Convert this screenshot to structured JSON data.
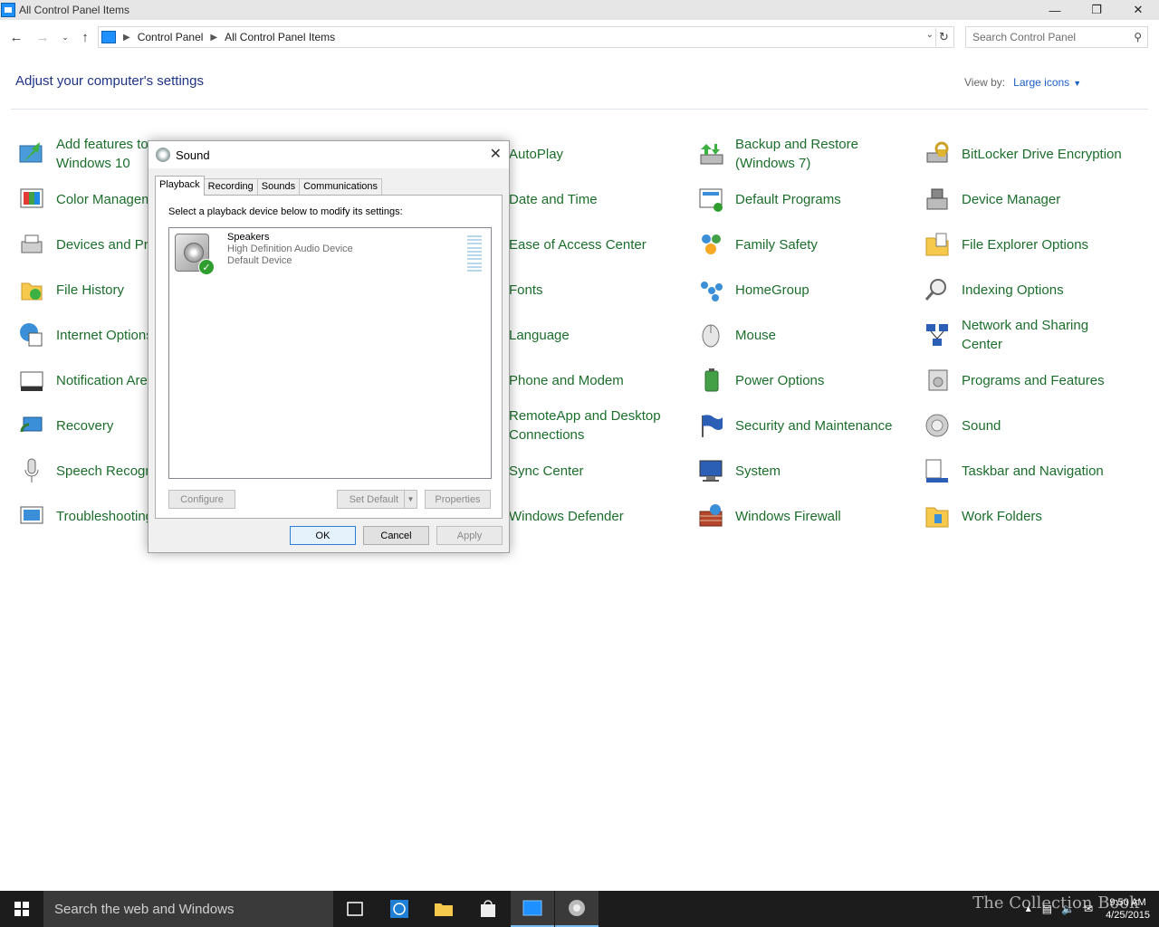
{
  "window": {
    "title": "All Control Panel Items"
  },
  "address": {
    "crumbs": [
      "Control Panel",
      "All Control Panel Items"
    ]
  },
  "search": {
    "placeholder": "Search Control Panel"
  },
  "header": {
    "heading": "Adjust your computer's settings",
    "view_by_label": "View by:",
    "view_by_value": "Large icons"
  },
  "items": [
    {
      "label": "Add features to Windows 10",
      "icon": "add-features-icon"
    },
    {
      "label": "Color Management",
      "icon": "color-management-icon"
    },
    {
      "label": "Devices and Printers",
      "icon": "devices-printers-icon"
    },
    {
      "label": "File History",
      "icon": "file-history-icon"
    },
    {
      "label": "Internet Options",
      "icon": "internet-options-icon"
    },
    {
      "label": "Notification Area Icons",
      "icon": "notification-area-icon"
    },
    {
      "label": "Recovery",
      "icon": "recovery-icon"
    },
    {
      "label": "Speech Recognition",
      "icon": "microphone-icon"
    },
    {
      "label": "Troubleshooting",
      "icon": "troubleshooting-icon"
    },
    {
      "label": "AutoPlay",
      "icon": "autoplay-icon"
    },
    {
      "label": "Date and Time",
      "icon": "clock-icon"
    },
    {
      "label": "Ease of Access Center",
      "icon": "ease-of-access-icon"
    },
    {
      "label": "Fonts",
      "icon": "fonts-icon"
    },
    {
      "label": "Language",
      "icon": "language-icon"
    },
    {
      "label": "Phone and Modem",
      "icon": "phone-icon"
    },
    {
      "label": "RemoteApp and Desktop Connections",
      "icon": "remoteapp-icon"
    },
    {
      "label": "Sync Center",
      "icon": "sync-icon"
    },
    {
      "label": "Windows Defender",
      "icon": "defender-icon"
    },
    {
      "label": "Backup and Restore (Windows 7)",
      "icon": "backup-icon"
    },
    {
      "label": "Default Programs",
      "icon": "default-programs-icon"
    },
    {
      "label": "Family Safety",
      "icon": "family-safety-icon"
    },
    {
      "label": "HomeGroup",
      "icon": "homegroup-icon"
    },
    {
      "label": "Mouse",
      "icon": "mouse-icon"
    },
    {
      "label": "Power Options",
      "icon": "power-options-icon"
    },
    {
      "label": "Security and Maintenance",
      "icon": "flag-icon"
    },
    {
      "label": "System",
      "icon": "system-icon"
    },
    {
      "label": "Windows Firewall",
      "icon": "firewall-icon"
    },
    {
      "label": "BitLocker Drive Encryption",
      "icon": "bitlocker-icon"
    },
    {
      "label": "Device Manager",
      "icon": "device-manager-icon"
    },
    {
      "label": "File Explorer Options",
      "icon": "folder-options-icon"
    },
    {
      "label": "Indexing Options",
      "icon": "indexing-icon"
    },
    {
      "label": "Network and Sharing Center",
      "icon": "network-icon"
    },
    {
      "label": "Programs and Features",
      "icon": "programs-icon"
    },
    {
      "label": "Sound",
      "icon": "speaker-icon"
    },
    {
      "label": "Taskbar and Navigation",
      "icon": "taskbar-icon"
    },
    {
      "label": "Work Folders",
      "icon": "work-folders-icon"
    }
  ],
  "dialog": {
    "title": "Sound",
    "tabs": [
      "Playback",
      "Recording",
      "Sounds",
      "Communications"
    ],
    "instruction": "Select a playback device below to modify its settings:",
    "device": {
      "name": "Speakers",
      "driver": "High Definition Audio Device",
      "status": "Default Device"
    },
    "buttons": {
      "configure": "Configure",
      "set_default": "Set Default",
      "properties": "Properties",
      "ok": "OK",
      "cancel": "Cancel",
      "apply": "Apply"
    }
  },
  "taskbar": {
    "search_placeholder": "Search the web and Windows",
    "time": "9:50 AM",
    "date": "4/25/2015",
    "watermark": "The Collection Book"
  },
  "colors": {
    "link_green": "#1b6e2b",
    "heading_blue": "#1e3287",
    "taskbar": "#1c1c1c"
  }
}
